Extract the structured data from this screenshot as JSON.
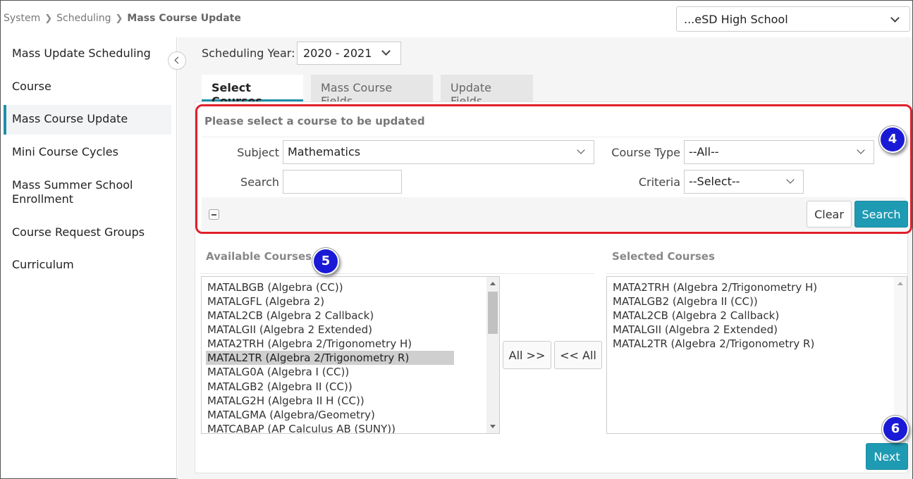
{
  "breadcrumb": {
    "items": [
      "System",
      "Scheduling"
    ],
    "current": "Mass Course Update"
  },
  "school_selector": {
    "value": "...eSD High School"
  },
  "sidebar": {
    "items": [
      {
        "label": "Mass Update Scheduling"
      },
      {
        "label": "Course"
      },
      {
        "label": "Mass Course Update"
      },
      {
        "label": "Mini Course Cycles"
      },
      {
        "label": "Mass Summer School Enrollment"
      },
      {
        "label": "Course Request Groups"
      },
      {
        "label": "Curriculum"
      }
    ],
    "active_index": 2
  },
  "scheduling_year": {
    "label": "Scheduling Year:",
    "value": "2020 - 2021"
  },
  "tabs": [
    {
      "label": "Select Courses",
      "active": true
    },
    {
      "label": "Mass Course Fields",
      "active": false
    },
    {
      "label": "Update Fields",
      "active": false
    }
  ],
  "filter": {
    "title": "Please select a course to be updated",
    "subject_label": "Subject",
    "subject_value": "Mathematics",
    "search_label": "Search",
    "search_value": "",
    "course_type_label": "Course Type",
    "course_type_value": "--All--",
    "criteria_label": "Criteria",
    "criteria_value": "--Select--",
    "clear_label": "Clear",
    "search_button_label": "Search"
  },
  "available": {
    "heading": "Available Courses",
    "items": [
      "MATALBGB (Algebra (CC))",
      "MATALGFL (Algebra 2)",
      "MATAL2CB (Algebra 2 Callback)",
      "MATALGII (Algebra 2 Extended)",
      "MATA2TRH (Algebra 2/Trigonometry H)",
      "MATAL2TR (Algebra 2/Trigonometry R)",
      "MATALG0A (Algebra I (CC))",
      "MATALGB2 (Algebra II (CC))",
      "MATALG2H (Algebra II H (CC))",
      "MATALGMA (Algebra/Geometry)",
      "MATCABAP (AP Calculus AB (SUNY))"
    ],
    "selected_index": 5
  },
  "move_buttons": {
    "all_right": "All >>",
    "all_left": "<< All"
  },
  "selected": {
    "heading": "Selected Courses",
    "items": [
      "MATA2TRH (Algebra 2/Trigonometry H)",
      "MATALGB2 (Algebra II (CC))",
      "MATAL2CB (Algebra 2 Callback)",
      "MATALGII (Algebra 2 Extended)",
      "MATAL2TR (Algebra 2/Trigonometry R)"
    ]
  },
  "next_label": "Next",
  "callouts": {
    "filter": "4",
    "available": "5",
    "next": "6"
  },
  "colors": {
    "accent": "#1f9ab3",
    "highlight_border": "#e0202a",
    "callout": "#1a1ad6"
  }
}
